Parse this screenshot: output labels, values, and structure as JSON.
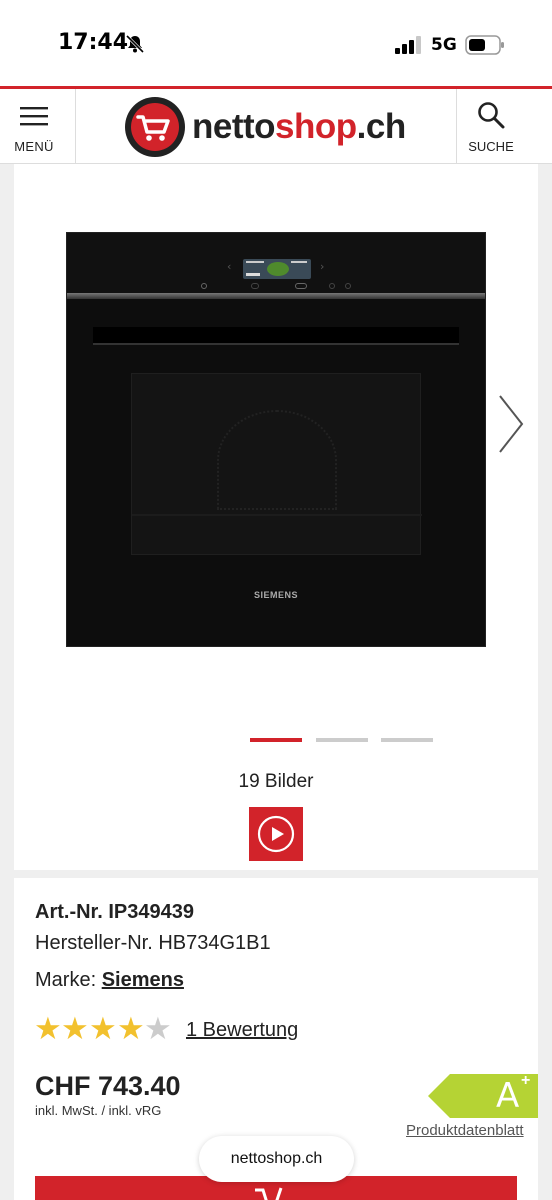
{
  "status_bar": {
    "time": "17:44",
    "network": "5G",
    "icons": [
      "bell-slash-icon",
      "signal-icon",
      "battery-icon"
    ]
  },
  "header": {
    "menu_label": "MENÜ",
    "search_label": "SUCHE",
    "logo": {
      "netto": "netto",
      "shop": "shop",
      "tld": ".ch"
    },
    "accent_color": "#d2232a"
  },
  "gallery": {
    "product_brand_on_image": "SIEMENS",
    "image_count": "19 Bilder",
    "current_slide": 1,
    "slides_visible": 3,
    "icons": [
      "chevron-right-icon",
      "play-icon"
    ]
  },
  "product": {
    "art_nr": "Art.-Nr. IP349439",
    "manufacturer_nr": "Hersteller-Nr. HB734G1B1",
    "brand_label": "Marke:",
    "brand_name": "Siemens",
    "rating": {
      "value": 4,
      "max": 5
    },
    "reviews": "1 Bewertung",
    "price": "CHF 743.40",
    "vat_note": "inkl. MwSt. / inkl. vRG",
    "energy_class": "A",
    "energy_class_sup": "+",
    "energy_color": "#b5d334",
    "datasheet_link": "Produktdatenblatt"
  },
  "browser": {
    "domain": "nettoshop.ch"
  }
}
